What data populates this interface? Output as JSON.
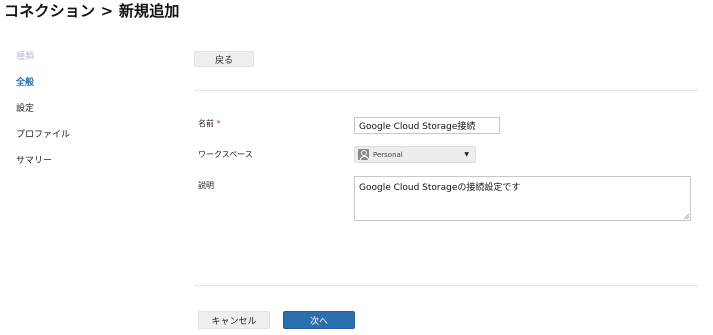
{
  "header": {
    "title": "コネクション > 新規追加"
  },
  "sidebar": {
    "items": [
      {
        "label": "種類"
      },
      {
        "label": "全般"
      },
      {
        "label": "設定"
      },
      {
        "label": "プロファイル"
      },
      {
        "label": "サマリー"
      }
    ]
  },
  "form": {
    "back_label": "戻る",
    "name": {
      "label": "名前",
      "required_mark": "*",
      "value": "Google Cloud Storage接続"
    },
    "workspace": {
      "label": "ワークスペース",
      "value": "Personal"
    },
    "description": {
      "label": "説明",
      "value": "Google Cloud Storageの接続設定です"
    }
  },
  "footer": {
    "cancel_label": "キャンセル",
    "next_label": "次へ"
  },
  "colors": {
    "accent": "#2d6fad",
    "active_nav": "#2a6fb2",
    "muted_nav": "#b7c3d6"
  },
  "icons": {
    "workspace": "user-icon",
    "dropdown": "caret-down-icon",
    "resize": "resize-grip-icon"
  }
}
